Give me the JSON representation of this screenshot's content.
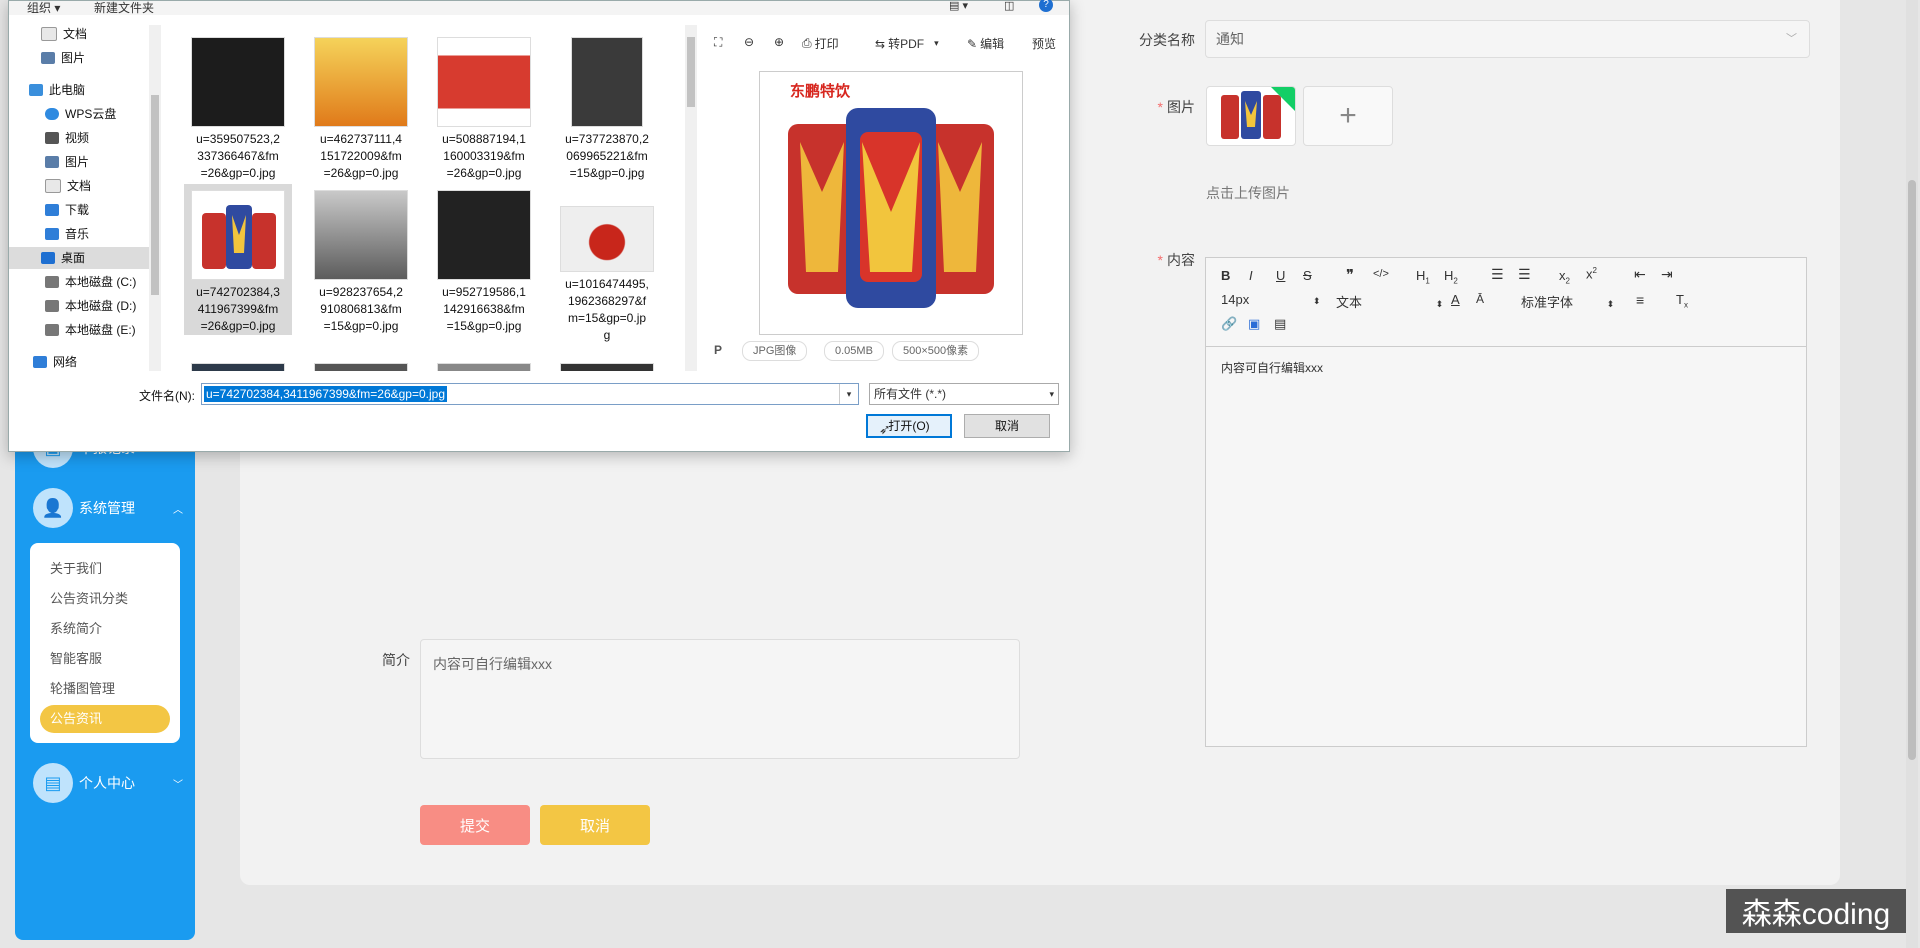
{
  "sidebar": {
    "menu_partial": "举报记录",
    "system_menu": "系统管理",
    "submenu": [
      "关于我们",
      "公告资讯分类",
      "系统简介",
      "智能客服",
      "轮播图管理",
      "公告资讯"
    ],
    "active_index": 5,
    "personal_menu": "个人中心"
  },
  "form": {
    "category_label": "分类名称",
    "category_value": "通知",
    "image_label": "图片",
    "upload_tip": "点击上传图片",
    "content_label": "内容",
    "intro_label": "简介",
    "intro_value": "内容可自行编辑xxx",
    "submit_label": "提交",
    "cancel_label": "取消"
  },
  "editor": {
    "font_size": "14px",
    "para_style": "文本",
    "font_family": "标准字体",
    "body_text": "内容可自行编辑xxx",
    "buttons": [
      "B",
      "I",
      "U",
      "S",
      "❞",
      "</>",
      "H1",
      "H2",
      "ol",
      "ul",
      "x₂",
      "x²",
      "indent-left",
      "indent-right"
    ]
  },
  "dialog": {
    "toolbar_organize": "组织 ▾",
    "toolbar_new_folder": "新建文件夹",
    "nav_tree": [
      {
        "label": "文档",
        "icon": "document-icon"
      },
      {
        "label": "图片",
        "icon": "picture-icon"
      },
      {
        "label": "此电脑",
        "icon": "computer-icon"
      },
      {
        "label": "WPS云盘",
        "icon": "cloud-icon"
      },
      {
        "label": "视频",
        "icon": "video-icon"
      },
      {
        "label": "图片",
        "icon": "picture-icon"
      },
      {
        "label": "文档",
        "icon": "document-icon"
      },
      {
        "label": "下载",
        "icon": "download-icon"
      },
      {
        "label": "音乐",
        "icon": "music-icon"
      },
      {
        "label": "桌面",
        "icon": "desktop-icon"
      },
      {
        "label": "本地磁盘 (C:)",
        "icon": "drive-icon"
      },
      {
        "label": "本地磁盘 (D:)",
        "icon": "drive-icon"
      },
      {
        "label": "本地磁盘 (E:)",
        "icon": "drive-icon"
      },
      {
        "label": "网络",
        "icon": "network-icon"
      }
    ],
    "selected_folder": "桌面",
    "files": [
      {
        "name_lines": [
          "u=359507523,2",
          "337366467&fm",
          "=26&gp=0.jpg"
        ],
        "color": "#1c1c1c"
      },
      {
        "name_lines": [
          "u=462737111,4",
          "151722009&fm",
          "=26&gp=0.jpg"
        ],
        "color": "#e8a32a"
      },
      {
        "name_lines": [
          "u=508887194,1",
          "160003319&fm",
          "=26&gp=0.jpg"
        ],
        "color": "#c9342d"
      },
      {
        "name_lines": [
          "u=737723870,2",
          "069965221&fm",
          "=15&gp=0.jpg"
        ],
        "color": "#3a3a3a"
      },
      {
        "name_lines": [
          "u=742702384,3",
          "411967399&fm",
          "=26&gp=0.jpg"
        ],
        "color": "#d24a2a",
        "selected": true
      },
      {
        "name_lines": [
          "u=928237654,2",
          "910806813&fm",
          "=15&gp=0.jpg"
        ],
        "color": "#6a6a6a"
      },
      {
        "name_lines": [
          "u=952719586,1",
          "142916638&fm",
          "=15&gp=0.jpg"
        ],
        "color": "#222"
      },
      {
        "name_lines": [
          "u=1016474495,",
          "1962368297&f",
          "m=15&gp=0.jp",
          "g"
        ],
        "color": "#c8261b"
      }
    ],
    "preview_toolbar": {
      "print": "打印",
      "to_pdf": "转PDF",
      "edit": "编辑",
      "preview": "预览"
    },
    "preview_brand": "东鹏特饮",
    "preview_badges": [
      "JPG图像",
      "0.05MB",
      "500×500像素"
    ],
    "filename_label": "文件名(N):",
    "filename_value": "u=742702384,3411967399&fm=26&gp=0.jpg",
    "filetype_value": "所有文件 (*.*)",
    "open_button": "打开(O)",
    "cancel_button": "取消"
  },
  "watermark": "森森coding",
  "colors": {
    "sidebar": "#1a9bf0",
    "active_menu": "#f3c644",
    "submit": "#f88d84",
    "cancel": "#f3c644"
  }
}
